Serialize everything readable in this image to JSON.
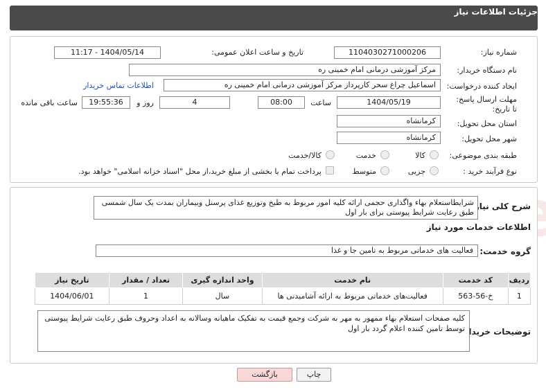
{
  "header": {
    "title": "جزئیات اطلاعات نیاز"
  },
  "form": {
    "need_number_label": "شماره نیاز:",
    "need_number": "1104030271000206",
    "announce_label": "تاریخ و ساعت اعلان عمومی:",
    "announce_value": "1404/05/14 - 11:17",
    "buyer_org_label": "نام دستگاه خریدار:",
    "buyer_org": "مرکز آموزشی درمانی امام خمینی ره",
    "creator_label": "ایجاد کننده درخواست:",
    "creator": "اسماعیل چراغ سحر کارپرداز مرکز آموزشی درمانی امام خمینی ره",
    "contact_link": "اطلاعات تماس خریدار",
    "deadline_label": "مهلت ارسال پاسخ: تا تاریخ:",
    "deadline_date": "1404/05/19",
    "time_label": "ساعت",
    "deadline_time": "08:00",
    "days_value": "4",
    "days_label": "روز و",
    "remaining_time": "19:55:36",
    "remaining_label": "ساعت باقی مانده",
    "province_label": "استان محل تحویل:",
    "province": "کرمانشاه",
    "city_label": "شهر محل تحویل:",
    "city": "کرمانشاه",
    "category_label": "طبقه بندی موضوعی:",
    "category_options": [
      "کالا",
      "خدمت",
      "کالا/خدمت"
    ],
    "process_label": "نوع فرآیند خرید :",
    "process_options": [
      "جزیی",
      "متوسط"
    ],
    "payment_note": "پرداخت تمام یا بخشی از مبلغ خرید،از محل \"اسناد خزانه اسلامی\" خواهد بود."
  },
  "details": {
    "summary_label": "شرح کلی نیاز:",
    "summary": "شرایطاستعلام بهاء واگذاری حجمی ارائه کلیه امور مربوط به طبخ وتوزیع غذای پرسنل وبیماران بمدت یک سال شمسی طبق رعایت شرایط پیوستی برای  بار اول",
    "services_title": "اطلاعات خدمات مورد نیاز",
    "service_group_label": "گروه خدمت:",
    "service_group": "فعالیت های خدماتی مربوط به تامین جا و غذا",
    "table": {
      "headers": [
        "ردیف",
        "کد خدمت",
        "نام خدمت",
        "واحد اندازه گیری",
        "تعداد / مقدار",
        "تاریخ نیاز"
      ],
      "rows": [
        [
          "1",
          "خ-56-563",
          "فعالیت‌های خدماتی مربوط به ارائه آشامیدنی ها",
          "سال",
          "1",
          "1404/06/01"
        ]
      ]
    },
    "buyer_notes_label": "توضیحات خریدار:",
    "buyer_notes": "کلیه صفحات استعلام بهاء ممهور به مهر به شرکت وجمع قیمت به تفکیک ماهیانه وسالانه به اعداد وحروف طبق رعایت شرایط پیوستی توسط تامین کننده اعلام گردد بار اول"
  },
  "buttons": {
    "print": "چاپ",
    "back": "بازگشت"
  },
  "watermark_text": "AriaTender.neT"
}
